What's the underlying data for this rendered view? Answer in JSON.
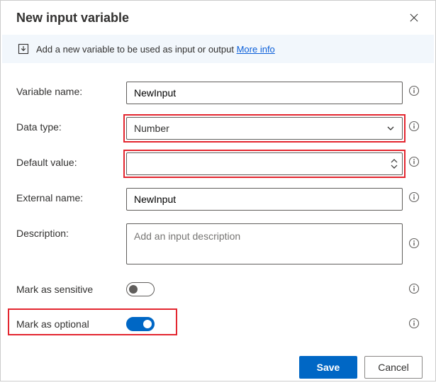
{
  "header": {
    "title": "New input variable"
  },
  "banner": {
    "text": "Add a new variable to be used as input or output",
    "link_text": "More info"
  },
  "labels": {
    "variable_name": "Variable name:",
    "data_type": "Data type:",
    "default_value": "Default value:",
    "external_name": "External name:",
    "description": "Description:",
    "mark_sensitive": "Mark as sensitive",
    "mark_optional": "Mark as optional"
  },
  "fields": {
    "variable_name_value": "NewInput",
    "data_type_value": "Number",
    "default_value_value": "",
    "external_name_value": "NewInput",
    "description_value": "",
    "description_placeholder": "Add an input description"
  },
  "toggles": {
    "sensitive": false,
    "optional": true
  },
  "footer": {
    "save": "Save",
    "cancel": "Cancel"
  }
}
